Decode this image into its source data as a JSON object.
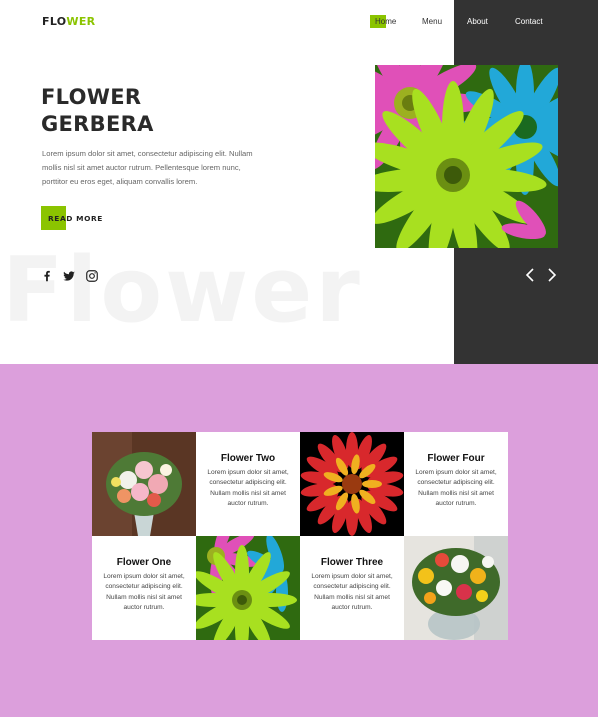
{
  "brand": {
    "logo_main": "FLO",
    "logo_accent": "WER",
    "accent_color": "#8bc400"
  },
  "nav": {
    "home": "Home",
    "menu": "Menu",
    "about": "About",
    "contact": "Contact"
  },
  "hero": {
    "title_line1": "FLOWER",
    "title_line2": "GERBERA",
    "description": "Lorem ipsum dolor sit amet, consectetur adipiscing elit. Nullam mollis nisl sit amet auctor rutrum. Pellentesque lorem nunc, porttitor eu eros eget, aliquam convallis lorem.",
    "cta_label": "READ MORE",
    "watermark": "Flower"
  },
  "social": [
    "facebook-icon",
    "twitter-icon",
    "instagram-icon"
  ],
  "colors": {
    "dark_panel": "#333333",
    "gallery_bg": "#dc9fdc"
  },
  "gallery": {
    "cards": [
      {
        "title": "Flower Two",
        "text": "Lorem ipsum dolor sit amet, consectetur adipiscing elit. Nullam mollis nisl sit amet auctor rutrum."
      },
      {
        "title": "Flower Four",
        "text": "Lorem ipsum dolor sit amet, consectetur adipiscing elit. Nullam mollis nisl sit amet auctor rutrum."
      },
      {
        "title": "Flower One",
        "text": "Lorem ipsum dolor sit amet, consectetur adipiscing elit. Nullam mollis nisl sit amet auctor rutrum."
      },
      {
        "title": "Flower Three",
        "text": "Lorem ipsum dolor sit amet, consectetur adipiscing elit. Nullam mollis nisl sit amet auctor rutrum."
      }
    ]
  }
}
